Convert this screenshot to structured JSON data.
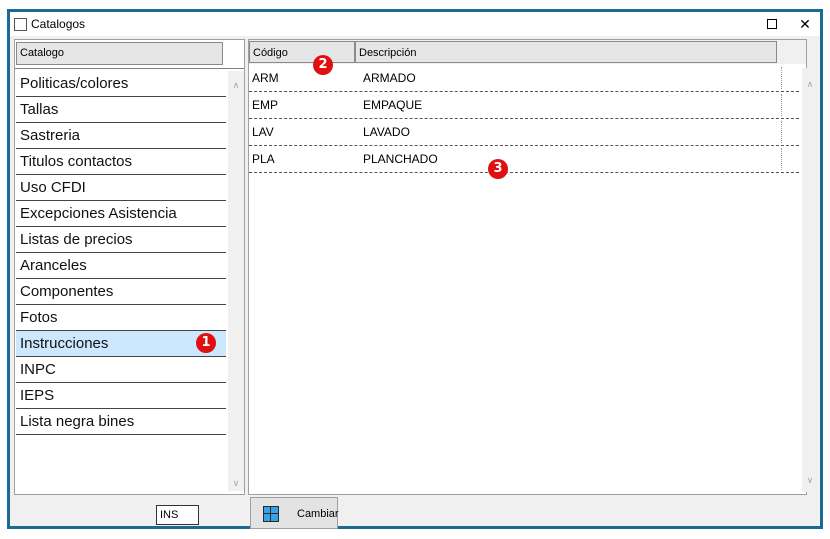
{
  "window": {
    "title": "Catalogos",
    "close_glyph": "✕"
  },
  "left_panel": {
    "header": "Catalogo",
    "items": [
      "Politicas/colores",
      "Tallas",
      "Sastreria",
      "Titulos contactos",
      "Uso CFDI",
      "Excepciones Asistencia",
      "Listas de precios",
      "Aranceles",
      "Componentes",
      "Fotos",
      "Instrucciones",
      "INPC",
      "IEPS",
      "Lista negra bines"
    ],
    "selected_index": 10
  },
  "grid": {
    "columns": [
      "Código",
      "Descripción"
    ],
    "rows": [
      {
        "code": "ARM",
        "desc": "ARMADO"
      },
      {
        "code": "EMP",
        "desc": "EMPAQUE"
      },
      {
        "code": "LAV",
        "desc": "LAVADO"
      },
      {
        "code": "PLA",
        "desc": "PLANCHADO"
      }
    ]
  },
  "bottom": {
    "ins_label": "INS",
    "cambiar_label": "Cambiar"
  },
  "badges": {
    "b1": "1",
    "b2": "2",
    "b3": "3"
  },
  "colors": {
    "frame": "#1c6a93",
    "selected": "#cce8ff",
    "badge": "#e01010",
    "cambiar_icon": "#37a3e6"
  },
  "scroll_glyphs": {
    "up": "∧",
    "down": "∨"
  }
}
